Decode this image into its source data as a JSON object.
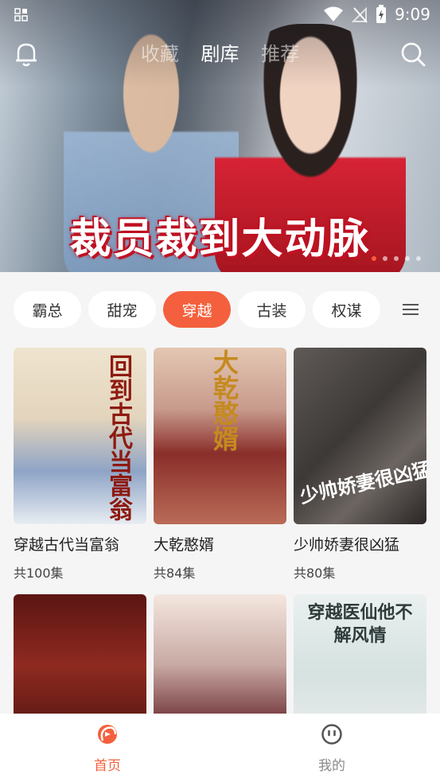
{
  "status_bar": {
    "time": "9:09"
  },
  "banner": {
    "title": "裁员裁到大动脉",
    "dots": 5,
    "active_dot": 1
  },
  "top_tabs": [
    {
      "label": "收藏",
      "active": false
    },
    {
      "label": "剧库",
      "active": true
    },
    {
      "label": "推荐",
      "active": false
    }
  ],
  "categories": [
    {
      "label": "霸总",
      "active": false
    },
    {
      "label": "甜宠",
      "active": false
    },
    {
      "label": "穿越",
      "active": true
    },
    {
      "label": "古装",
      "active": false
    },
    {
      "label": "权谋",
      "active": false
    }
  ],
  "dramas": [
    {
      "title": "穿越古代当富翁",
      "episodes": "共100集",
      "poster_text": "回到古代当富翁"
    },
    {
      "title": "大乾憨婿",
      "episodes": "共84集",
      "poster_text": "大乾憨婿"
    },
    {
      "title": "少帅娇妻很凶猛",
      "episodes": "共80集",
      "poster_text": "少帅娇妻很凶猛"
    },
    {
      "title": "",
      "episodes": "",
      "poster_text": ""
    },
    {
      "title": "",
      "episodes": "",
      "poster_text": ""
    },
    {
      "title": "",
      "episodes": "",
      "poster_text": "穿越医仙他不解风情"
    }
  ],
  "bottom_nav": [
    {
      "label": "首页",
      "active": true
    },
    {
      "label": "我的",
      "active": false
    }
  ],
  "colors": {
    "accent": "#f4603d",
    "background": "#f5f5f5"
  }
}
